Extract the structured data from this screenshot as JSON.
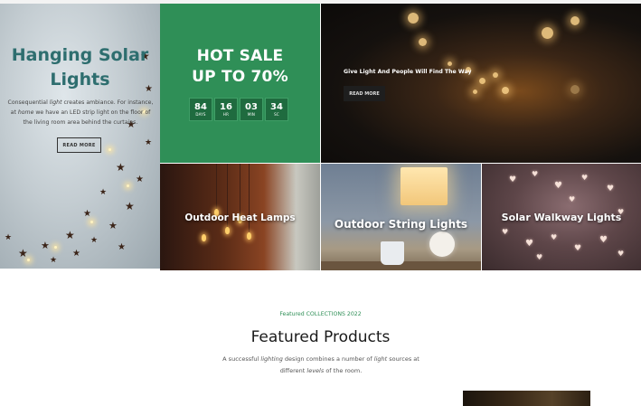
{
  "solar": {
    "title_line1": "Hanging Solar",
    "title_line2": "Lights",
    "desc_part1": "Consequential ",
    "desc_em1": "light",
    "desc_part2": " creates ambiance. For instance, at ",
    "desc_em2": "home",
    "desc_part3": " we have an LED strip light on the floor of the living room area behind the curtains.",
    "button": "READ MORE"
  },
  "sale": {
    "line1": "HOT SALE",
    "line2": "UP TO 70%",
    "countdown": [
      {
        "num": "84",
        "label": "DAYS"
      },
      {
        "num": "16",
        "label": "HR"
      },
      {
        "num": "03",
        "label": "MIN"
      },
      {
        "num": "34",
        "label": "SC"
      }
    ]
  },
  "hands": {
    "caption": "Give Light And People Will Find The Way",
    "button": "READ MORE"
  },
  "categories": {
    "heat": "Outdoor Heat Lamps",
    "string": "Outdoor String Lights",
    "walkway": "Solar Walkway Lights"
  },
  "featured": {
    "kicker": "Featured COLLECTIONS 2022",
    "title": "Featured Products",
    "desc_part1": "A successful ",
    "desc_em1": "lighting",
    "desc_part2": " design combines a number of ",
    "desc_em2": "light",
    "desc_part3": " sources at different ",
    "desc_em3": "levels",
    "desc_part4": " of the room."
  },
  "colors": {
    "accent_green": "#2f8f57",
    "solar_title": "#2e6e6f"
  }
}
